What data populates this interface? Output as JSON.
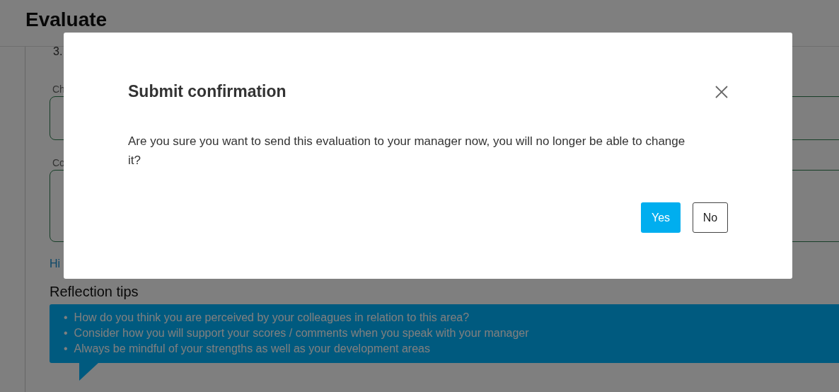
{
  "page": {
    "title": "Evaluate",
    "question_number": "3.",
    "fields": [
      {
        "label": "Ch",
        "kind": "short"
      },
      {
        "label": "Co",
        "kind": "tall"
      }
    ],
    "link": "Hi",
    "reflection_tips": {
      "heading": "Reflection tips",
      "marker": "•",
      "items": [
        "How do you think you are perceived by your colleagues in relation to this area?",
        "Consider how you will support your scores / comments when you speak with your manager",
        "Always be mindful of your strengths as well as your development areas"
      ]
    }
  },
  "dialog": {
    "title": "Submit confirmation",
    "message": "Are you sure you want to send this evaluation to your manager now, you will no longer be able to change it?",
    "buttons": [
      {
        "label": "Yes",
        "kind": "primary"
      },
      {
        "label": "No",
        "kind": "secondary"
      }
    ]
  }
}
